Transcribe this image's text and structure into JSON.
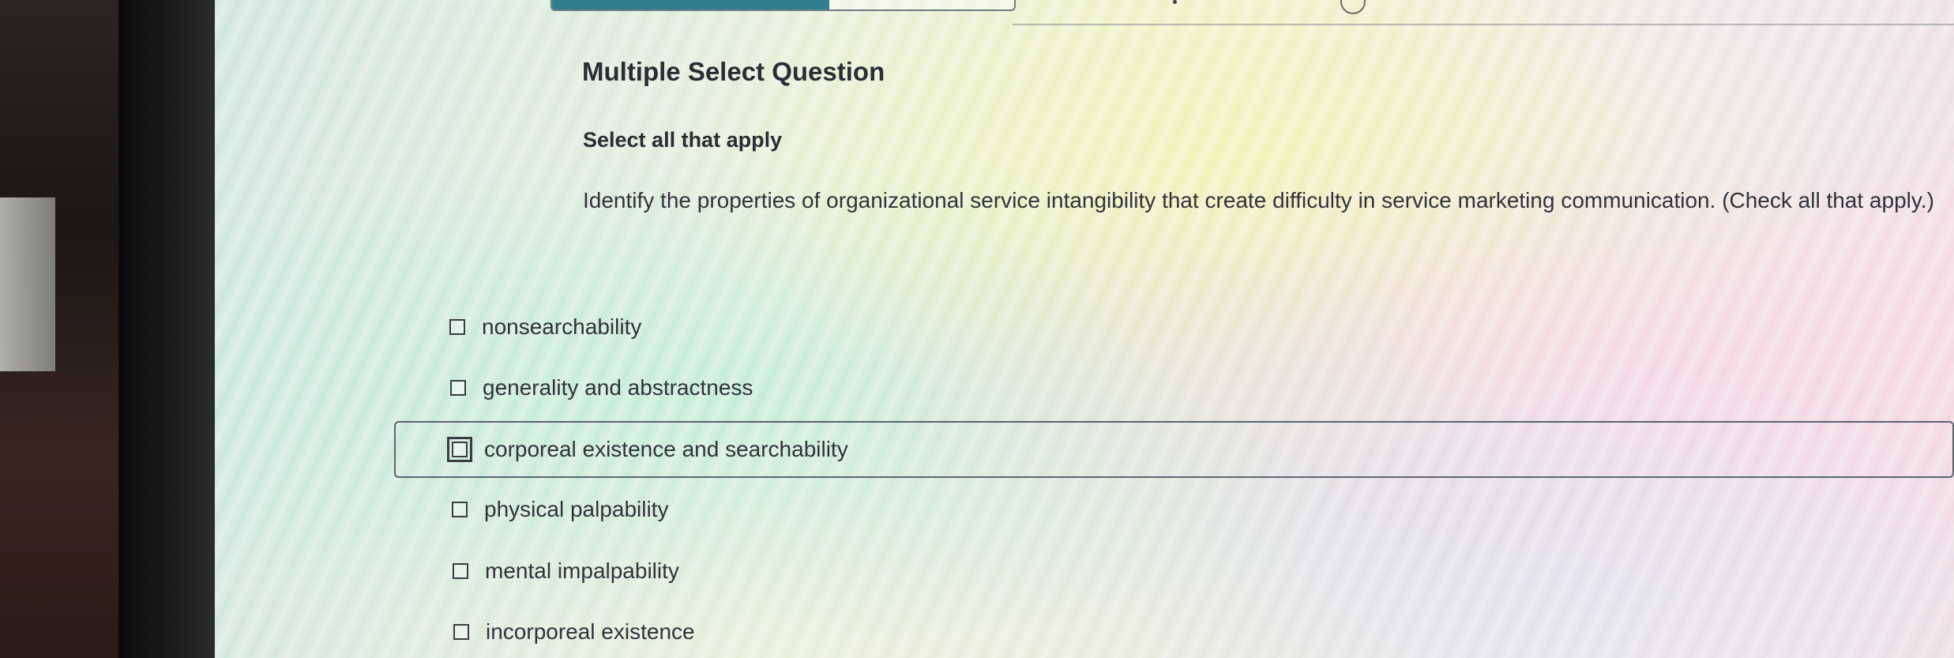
{
  "progress": {
    "fraction": 0.6
  },
  "question": {
    "type_label": "Multiple Select Question",
    "instruction": "Select all that apply",
    "prompt": "Identify the properties of organizational service intangibility that create difficulty in service marketing communication. (Check all that apply.)"
  },
  "options": [
    {
      "label": "nonsearchability",
      "checked": false
    },
    {
      "label": "generality and abstractness",
      "checked": false
    },
    {
      "label": "corporeal existence and searchability",
      "checked": false,
      "focused": true
    },
    {
      "label": "physical palpability",
      "checked": false
    },
    {
      "label": "mental impalpability",
      "checked": false
    },
    {
      "label": "incorporeal existence",
      "checked": false
    }
  ],
  "colors": {
    "progress_fill": "#2f7f8f",
    "text": "#30333a"
  }
}
